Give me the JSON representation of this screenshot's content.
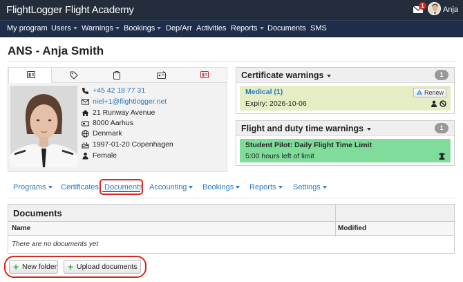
{
  "app": {
    "title": "FlightLogger Flight Academy",
    "notification_count": "1",
    "user_name": "Anja"
  },
  "nav": [
    {
      "label": "My program",
      "dropdown": false
    },
    {
      "label": "Users",
      "dropdown": true
    },
    {
      "label": "Warnings",
      "dropdown": true
    },
    {
      "label": "Bookings",
      "dropdown": true
    },
    {
      "label": "Dep/Arr",
      "dropdown": false
    },
    {
      "label": "Activities",
      "dropdown": false
    },
    {
      "label": "Reports",
      "dropdown": true
    },
    {
      "label": "Documents",
      "dropdown": false
    },
    {
      "label": "SMS",
      "dropdown": false
    }
  ],
  "page": {
    "title": "ANS - Anja Smith"
  },
  "profile": {
    "tabs": [
      "id-card-icon",
      "tag-icon",
      "clipboard-icon",
      "id-badge-icon",
      "license-icon"
    ],
    "phone": "+45 42 18 77 31",
    "email": "niel+1@flightlogger.net",
    "address": "21 Runway Avenue",
    "city": "8000 Aarhus",
    "country": "Denmark",
    "birth": "1997-01-20 Copenhagen",
    "gender": "Female"
  },
  "certificate_warnings": {
    "title": "Certificate warnings",
    "count": "1",
    "item_title": "Medical (1)",
    "item_detail": "Expiry: 2026-10-06",
    "renew_label": "Renew",
    "bg_color": "#e4edc3"
  },
  "flight_duty_warnings": {
    "title": "Flight and duty time warnings",
    "count": "1",
    "item_title": "Student Pilot: Daily Flight Time Limit",
    "item_detail": "5:00 hours left of limit",
    "bg_color": "#7fdc9a"
  },
  "subnav": [
    {
      "label": "Programs",
      "dropdown": true
    },
    {
      "label": "Certificates",
      "dropdown": false
    },
    {
      "label": "Documents",
      "dropdown": false,
      "active": true
    },
    {
      "label": "Accounting",
      "dropdown": true
    },
    {
      "label": "Bookings",
      "dropdown": true
    },
    {
      "label": "Reports",
      "dropdown": true
    },
    {
      "label": "Settings",
      "dropdown": true
    }
  ],
  "documents": {
    "title": "Documents",
    "columns": [
      "Name",
      "Modified"
    ],
    "empty_text": "There are no documents yet"
  },
  "actions": {
    "new_folder": "New folder",
    "upload": "Upload documents"
  },
  "colors": {
    "topbar": "#232d3b",
    "navbar": "#1d2d4a",
    "link": "#2b79c2",
    "highlight": "#d9251c"
  }
}
